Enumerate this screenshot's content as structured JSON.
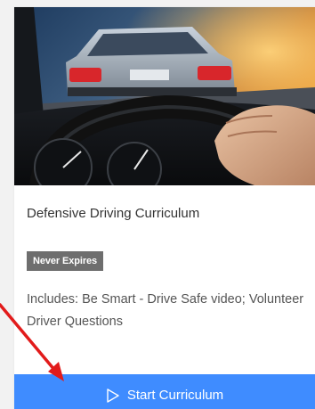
{
  "card": {
    "title": "Defensive Driving Curriculum",
    "badge": "Never Expires",
    "description": "Includes: Be Smart - Drive Safe video; Volunteer Driver Questions",
    "start_button_label": "Start Curriculum",
    "image_alt": "Driver hand on steering wheel behind a car"
  },
  "icons": {
    "start_button": "play-outline-icon",
    "annotation": "red-arrow-icon"
  },
  "colors": {
    "button_bg": "#3f8cff",
    "badge_bg": "#6e6e6e",
    "annotation_arrow": "#e21b1b"
  }
}
